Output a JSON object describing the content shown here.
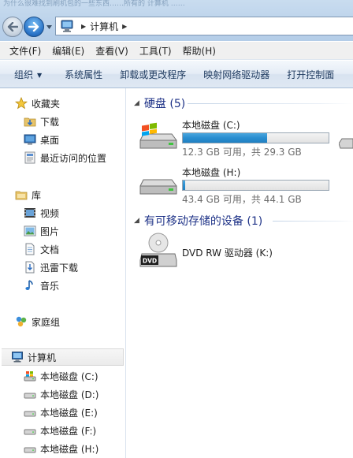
{
  "window": {
    "title_strip": "为什么很难找到刷机包的一些东西……所有的 计算机 ……"
  },
  "address_bar": {
    "path": "计算机"
  },
  "menu": [
    "文件(F)",
    "编辑(E)",
    "查看(V)",
    "工具(T)",
    "帮助(H)"
  ],
  "commands": {
    "organize": "组织",
    "items": [
      "系统属性",
      "卸载或更改程序",
      "映射网络驱动器",
      "打开控制面"
    ]
  },
  "nav": {
    "favorites": {
      "label": "收藏夹",
      "items": [
        "下载",
        "桌面",
        "最近访问的位置"
      ]
    },
    "libraries": {
      "label": "库",
      "items": [
        "视频",
        "图片",
        "文档",
        "迅雷下载",
        "音乐"
      ]
    },
    "homegroup": {
      "label": "家庭组"
    },
    "computer": {
      "label": "计算机",
      "items": [
        "本地磁盘 (C:)",
        "本地磁盘 (D:)",
        "本地磁盘 (E:)",
        "本地磁盘 (F:)",
        "本地磁盘 (H:)"
      ]
    }
  },
  "content": {
    "hard_disks": {
      "title": "硬盘 (5)",
      "drives": [
        {
          "name": "本地磁盘 (C:)",
          "info": "12.3 GB 可用，共 29.3 GB",
          "used_fraction": 0.58,
          "system": true
        },
        {
          "name": "本地磁盘 (H:)",
          "info": "43.4 GB 可用，共 44.1 GB",
          "used_fraction": 0.016,
          "system": false
        }
      ]
    },
    "removable": {
      "title": "有可移动存储的设备 (1)",
      "devices": [
        {
          "name": "DVD RW 驱动器 (K:)",
          "icon_label": "DVD"
        }
      ]
    }
  },
  "colors": {
    "usage_bar": "#2a8ed0",
    "group_title": "#1e3287",
    "free_space_text": "#6d6d6d"
  }
}
